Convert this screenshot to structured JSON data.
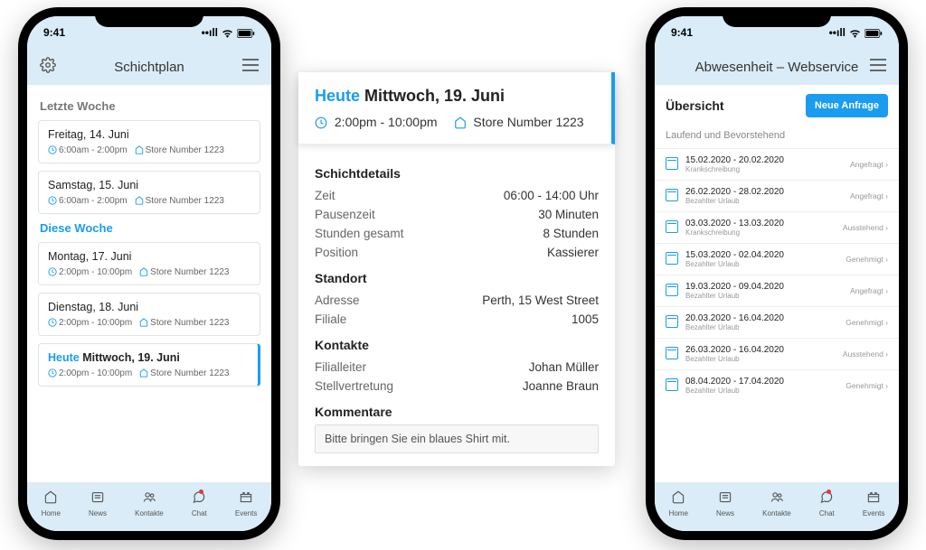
{
  "status_time": "9:41",
  "phone1": {
    "title": "Schichtplan",
    "last_week_label": "Letzte Woche",
    "this_week_label": "Diese Woche",
    "last_week": [
      {
        "date": "Freitag, 14. Juni",
        "time": "6:00am - 2:00pm",
        "store": "Store Number 1223"
      },
      {
        "date": "Samstag, 15. Juni",
        "time": "6:00am - 2:00pm",
        "store": "Store Number 1223"
      }
    ],
    "this_week": [
      {
        "date": "Montag, 17. Juni",
        "time": "2:00pm - 10:00pm",
        "store": "Store Number 1223"
      },
      {
        "date": "Dienstag, 18. Juni",
        "time": "2:00pm - 10:00pm",
        "store": "Store Number 1223"
      },
      {
        "today": "Heute",
        "date": "Mittwoch, 19. Juni",
        "time": "2:00pm - 10:00pm",
        "store": "Store Number 1223",
        "highlight": true
      }
    ]
  },
  "detail": {
    "today": "Heute",
    "date": "Mittwoch, 19. Juni",
    "time": "2:00pm - 10:00pm",
    "store": "Store Number 1223",
    "section_schichtdetails": "Schichtdetails",
    "zeit_label": "Zeit",
    "zeit_val": "06:00 - 14:00 Uhr",
    "pause_label": "Pausenzeit",
    "pause_val": "30 Minuten",
    "stunden_label": "Stunden gesamt",
    "stunden_val": "8 Stunden",
    "position_label": "Position",
    "position_val": "Kassierer",
    "section_standort": "Standort",
    "adresse_label": "Adresse",
    "adresse_val": "Perth, 15 West Street",
    "filiale_label": "Filiale",
    "filiale_val": "1005",
    "section_kontakte": "Kontakte",
    "leiter_label": "Filialleiter",
    "leiter_val": "Johan Müller",
    "vertretung_label": "Stellvertretung",
    "vertretung_val": "Joanne Braun",
    "section_kommentare": "Kommentare",
    "kommentar": "Bitte bringen Sie ein blaues Shirt mit."
  },
  "phone2": {
    "title": "Abwesenheit – Webservice",
    "overview": "Übersicht",
    "new_request": "Neue Anfrage",
    "subtitle": "Laufend und Bevorstehend",
    "items": [
      {
        "range": "15.02.2020 - 20.02.2020",
        "type": "Krankschreibung",
        "status": "Angefragt"
      },
      {
        "range": "26.02.2020 - 28.02.2020",
        "type": "Bezahlter Urlaub",
        "status": "Angefragt"
      },
      {
        "range": "03.03.2020 - 13.03.2020",
        "type": "Krankschreibung",
        "status": "Ausstehend"
      },
      {
        "range": "15.03.2020 - 02.04.2020",
        "type": "Bezahlter Urlaub",
        "status": "Genehmigt"
      },
      {
        "range": "19.03.2020 - 09.04.2020",
        "type": "Bezahlter Urlaub",
        "status": "Angefragt"
      },
      {
        "range": "20.03.2020 - 16.04.2020",
        "type": "Bezahlter Urlaub",
        "status": "Genehmigt"
      },
      {
        "range": "26.03.2020 - 16.04.2020",
        "type": "Bezahlter Urlaub",
        "status": "Ausstehend"
      },
      {
        "range": "08.04.2020 - 17.04.2020",
        "type": "Bezahlter Urlaub",
        "status": "Genehmigt"
      }
    ]
  },
  "nav": [
    {
      "label": "Home"
    },
    {
      "label": "News"
    },
    {
      "label": "Kontakte"
    },
    {
      "label": "Chat",
      "dot": true
    },
    {
      "label": "Events"
    }
  ]
}
